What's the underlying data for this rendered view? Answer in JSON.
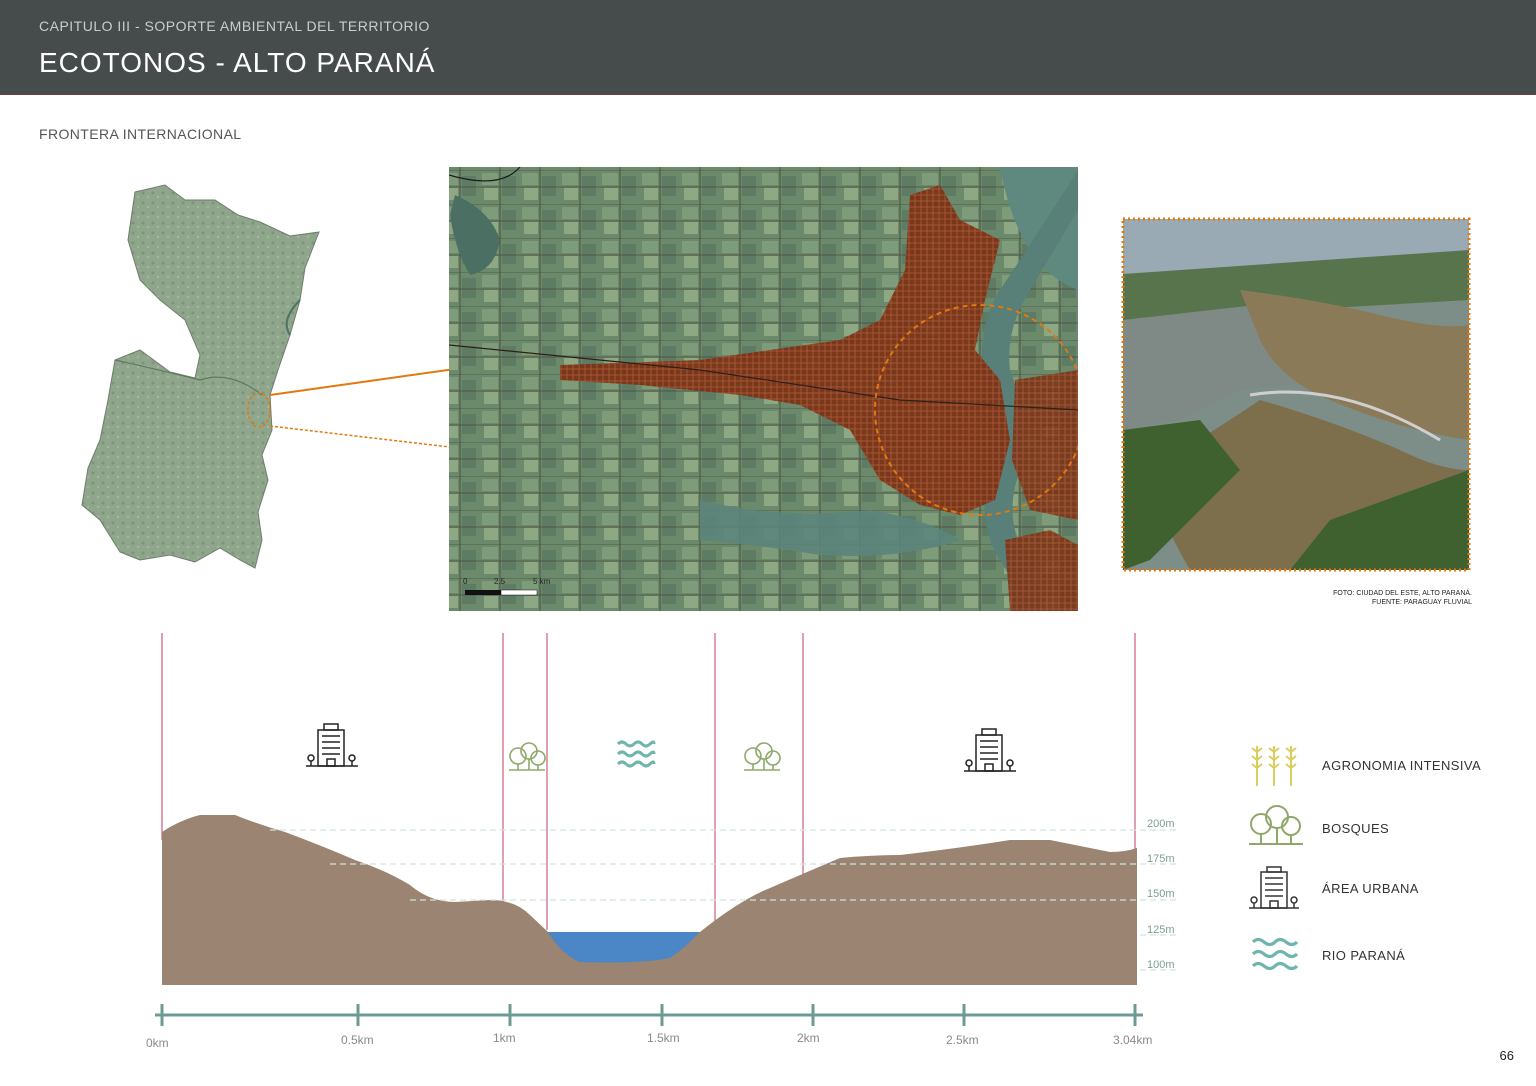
{
  "header": {
    "chapter": "CAPITULO III - SOPORTE AMBIENTAL DEL TERRITORIO",
    "title": "ECOTONOS - ALTO PARANÁ"
  },
  "section": {
    "subtitle": "FRONTERA INTERNACIONAL"
  },
  "map": {
    "scale": [
      "0",
      "2.5",
      "5 km"
    ]
  },
  "photo": {
    "caption_line1": "FOTO: CIUDAD DEL ESTE, ALTO PARANÁ.",
    "caption_line2": "FUENTE: PARAGUAY FLUVIAL"
  },
  "profile": {
    "distance_labels": [
      "0km",
      "0.5km",
      "1km",
      "1.5km",
      "2km",
      "2.5km",
      "3.04km"
    ],
    "elevation_labels": [
      "200m",
      "175m",
      "150m",
      "125m",
      "100m"
    ],
    "zones": [
      "urban-icon",
      "forest-icon",
      "water-icon",
      "forest-icon",
      "urban-icon"
    ]
  },
  "legend": [
    {
      "icon": "wheat-icon",
      "label": "AGRONOMIA INTENSIVA",
      "color": "#d9cf5e"
    },
    {
      "icon": "forest-icon",
      "label": "BOSQUES",
      "color": "#8ea86a"
    },
    {
      "icon": "building-icon",
      "label": "ÁREA URBANA",
      "color": "#333333"
    },
    {
      "icon": "water-icon",
      "label": "RIO PARANÁ",
      "color": "#6fb5ad"
    }
  ],
  "page_number": "66",
  "colors": {
    "terrain": "#9b8471",
    "river": "#4b86c6",
    "divider": "#c9607a",
    "axis": "#6c9b94",
    "accent": "#e07a10"
  }
}
